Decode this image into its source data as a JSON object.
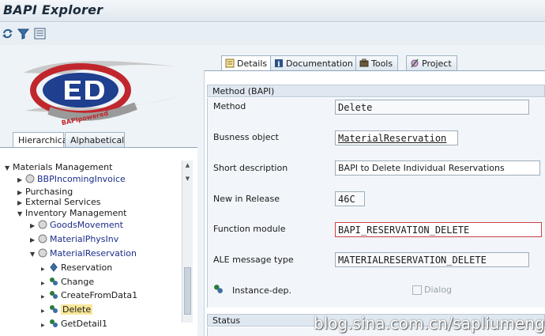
{
  "window": {
    "title": "BAPI Explorer"
  },
  "toolbar": {
    "icons": [
      "refresh-icon",
      "filter-icon",
      "list-icon"
    ]
  },
  "logo": {
    "text": "BAPIpowered"
  },
  "left_tabs": [
    {
      "label": "Hierarchical",
      "active": true
    },
    {
      "label": "Alphabetical",
      "active": false
    }
  ],
  "tree": [
    {
      "label": "Materials Management",
      "expanded": true
    },
    {
      "label": "BBPIncomingInvoice"
    },
    {
      "label": "Purchasing"
    },
    {
      "label": "External Services"
    },
    {
      "label": "Inventory Management",
      "expanded": true
    },
    {
      "label": "GoodsMovement"
    },
    {
      "label": "MaterialPhysInv"
    },
    {
      "label": "MaterialReservation",
      "expanded": true
    },
    {
      "label": "Reservation"
    },
    {
      "label": "Change"
    },
    {
      "label": "CreateFromData1"
    },
    {
      "label": "Delete",
      "selected": true
    },
    {
      "label": "GetDetail1"
    }
  ],
  "right_tabs": [
    {
      "label": "Details",
      "active": true,
      "icon": "details-icon"
    },
    {
      "label": "Documentation",
      "active": false,
      "icon": "info-icon"
    },
    {
      "label": "Tools",
      "active": false,
      "icon": "tools-icon"
    },
    {
      "label": "Project",
      "active": false,
      "icon": "project-icon"
    }
  ],
  "method_group": {
    "title": "Method (BAPI)",
    "method_label": "Method",
    "method_value": "Delete",
    "bo_label": "Busness object",
    "bo_value": "MaterialReservation",
    "short_desc_label": "Short description",
    "short_desc_value": "BAPI to Delete Individual Reservations",
    "release_label": "New in Release",
    "release_value": "46C",
    "fm_label": "Function module",
    "fm_value": "BAPI_RESERVATION_DELETE",
    "ale_label": "ALE message type",
    "ale_value": "MATERIALRESERVATION_DELETE",
    "instance_label": "Instance-dep.",
    "dialog_label": "Dialog",
    "dialog_checked": false
  },
  "status_group": {
    "title": "Status"
  },
  "watermark": "blog.sina.com.cn/sapliumeng"
}
